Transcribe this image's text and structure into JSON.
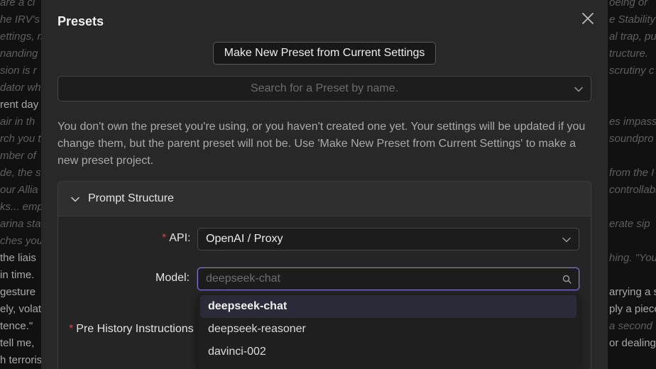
{
  "background": {
    "left_lines": [
      {
        "text": "are a cl",
        "style": "it"
      },
      {
        "text": "he IRV's",
        "style": "it"
      },
      {
        "text": "ettings, m",
        "style": "it"
      },
      {
        "text": "nanding",
        "style": "it"
      },
      {
        "text": "sion is r",
        "style": "it"
      },
      {
        "text": "dator wh",
        "style": "it"
      },
      {
        "text": "rent day",
        "style": "bright"
      },
      {
        "text": "air in th",
        "style": "it"
      },
      {
        "text": "rch you t",
        "style": "it"
      },
      {
        "text": "mber of",
        "style": "it"
      },
      {
        "text": "de, the s",
        "style": "it"
      },
      {
        "text": "our Allia",
        "style": "it"
      },
      {
        "text": "ks... emp",
        "style": "it"
      },
      {
        "text": "arina sta",
        "style": "it"
      },
      {
        "text": "ches you",
        "style": "it"
      },
      {
        "text": "the liais",
        "style": "bright"
      },
      {
        "text": "in time.",
        "style": "bright"
      },
      {
        "text": "gesture",
        "style": "bright"
      },
      {
        "text": "ely, volati",
        "style": "bright"
      },
      {
        "text": "tence.\"",
        "style": "bright"
      },
      {
        "text": "tell me,",
        "style": "bright"
      },
      {
        "text": "h terroris",
        "style": "bright"
      }
    ],
    "right_lines": [
      {
        "text": "oeing or",
        "style": "it"
      },
      {
        "text": "e Stability",
        "style": "it"
      },
      {
        "text": "al trap, pu",
        "style": "it"
      },
      {
        "text": "tructure.",
        "style": "it"
      },
      {
        "text": "scrutiny c",
        "style": "it"
      },
      {
        "text": "",
        "style": "it"
      },
      {
        "text": "",
        "style": "it"
      },
      {
        "text": "es impass",
        "style": "it"
      },
      {
        "text": "soundpro",
        "style": "it"
      },
      {
        "text": "",
        "style": "it"
      },
      {
        "text": "from the I",
        "style": "it"
      },
      {
        "text": "controllabl",
        "style": "it"
      },
      {
        "text": "",
        "style": "it"
      },
      {
        "text": "erate sip",
        "style": "it"
      },
      {
        "text": "",
        "style": "it"
      },
      {
        "text": "hing. \"You",
        "style": "it"
      },
      {
        "text": "",
        "style": "it"
      },
      {
        "text": "arrying a s",
        "style": "bright"
      },
      {
        "text": "ply a piece",
        "style": "bright"
      },
      {
        "text": "a second",
        "style": "it"
      },
      {
        "text": "or dealing",
        "style": "bright"
      },
      {
        "text": "",
        "style": "it"
      }
    ]
  },
  "modal": {
    "title": "Presets",
    "new_preset_label": "Make New Preset from Current Settings",
    "search_placeholder": "Search for a Preset by name.",
    "info_text": "You don't own the preset you're using, or you haven't created one yet. Your settings will be updated if you change them, but the parent preset will not be. Use 'Make New Preset from Current Settings' to make a new preset project.",
    "section": {
      "title": "Prompt Structure",
      "api_label": "API",
      "api_required": "*",
      "api_value": "OpenAI / Proxy",
      "model_label": "Model",
      "model_placeholder": "deepseek-chat",
      "pre_history_label": "Pre History Instructions",
      "pre_history_required": "*",
      "model_options": [
        "deepseek-chat",
        "deepseek-reasoner",
        "davinci-002"
      ]
    }
  },
  "colors": {
    "accent": "#8877dd",
    "required": "#d34545",
    "modal_bg": "#282828"
  }
}
